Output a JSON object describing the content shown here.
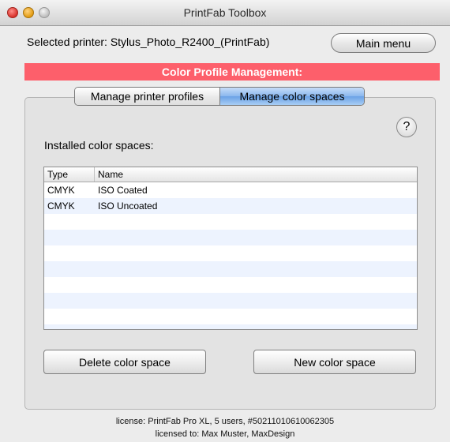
{
  "window": {
    "title": "PrintFab Toolbox"
  },
  "header": {
    "selected_printer": "Selected printer: Stylus_Photo_R2400_(PrintFab)",
    "main_menu_label": "Main menu"
  },
  "section": {
    "banner": "Color Profile Management:",
    "banner_color": "#fd5f6b"
  },
  "tabs": [
    {
      "label": "Manage printer profiles",
      "active": false
    },
    {
      "label": "Manage color spaces",
      "active": true
    }
  ],
  "help": {
    "label": "?",
    "icon": "help-icon"
  },
  "installed_label": "Installed color spaces:",
  "table": {
    "columns": [
      "Type",
      "Name"
    ],
    "rows": [
      {
        "type": "CMYK",
        "name": "ISO Coated"
      },
      {
        "type": "CMYK",
        "name": "ISO Uncoated"
      }
    ],
    "stripe_color": "#edf3fe"
  },
  "buttons": {
    "delete_label": "Delete color space",
    "new_label": "New color space"
  },
  "license": {
    "line1": "license: PrintFab Pro XL, 5 users, #50211010610062305",
    "line2": "licensed to: Max Muster, MaxDesign"
  }
}
